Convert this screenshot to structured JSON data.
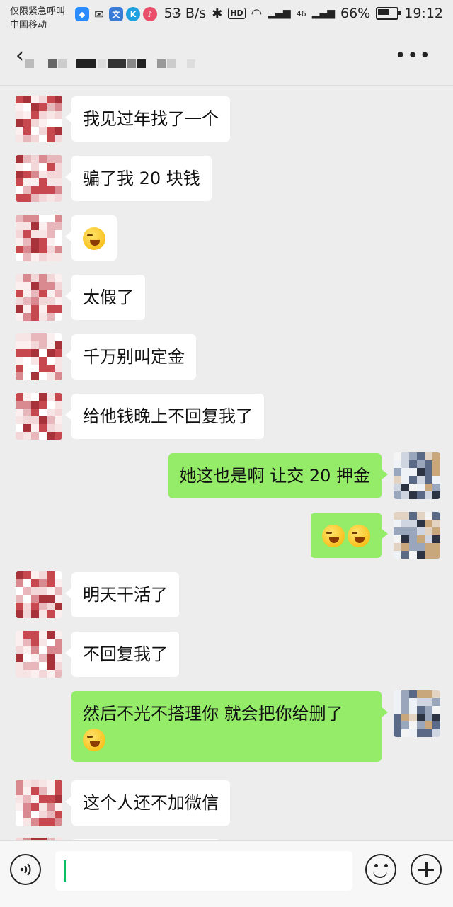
{
  "status_bar": {
    "carrier_line1": "仅限紧急呼叫",
    "carrier_line2": "中国移动",
    "net_speed": "53 B/s",
    "hd": "HD",
    "signal": "46",
    "battery": "66%",
    "battery_level": 0.66,
    "time": "19:12"
  },
  "nav": {
    "back_icon": "chevron-left-icon",
    "more_icon": "ellipsis-icon"
  },
  "messages": [
    {
      "side": "in",
      "text": "我见过年找了一个"
    },
    {
      "side": "in",
      "text": "骗了我 20 块钱"
    },
    {
      "side": "in",
      "emoji_count": 1
    },
    {
      "side": "in",
      "text": "太假了"
    },
    {
      "side": "in",
      "text": "千万别叫定金"
    },
    {
      "side": "in",
      "text": "给他钱晚上不回复我了"
    },
    {
      "side": "out",
      "text": "她这也是啊  让交 20 押金"
    },
    {
      "side": "out",
      "emoji_count": 2
    },
    {
      "side": "in",
      "text": "明天干活了"
    },
    {
      "side": "in",
      "text": "不回复我了"
    },
    {
      "side": "out",
      "text": "然后不光不搭理你 就会把你给删了",
      "emoji_count": 1
    },
    {
      "side": "in",
      "text": "这个人还不加微信"
    }
  ],
  "input_bar": {
    "voice_icon": "voice-icon",
    "emoji_icon": "smiley-icon",
    "plus_icon": "plus-circle-icon"
  }
}
